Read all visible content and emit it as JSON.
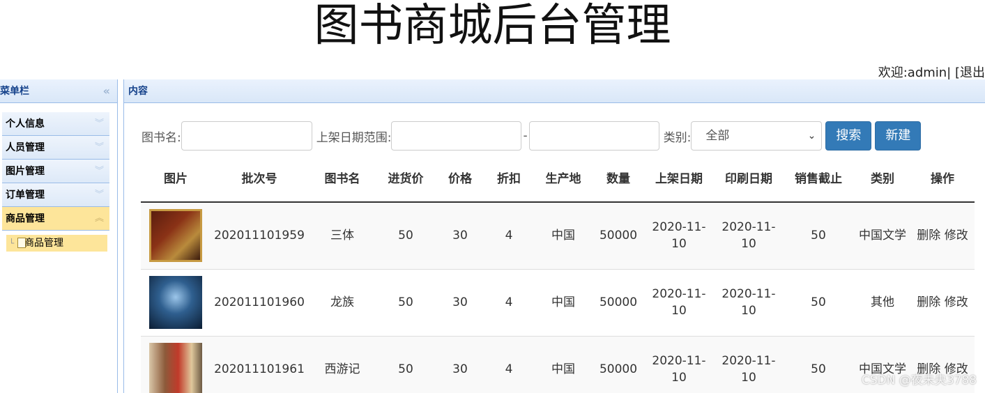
{
  "header": {
    "title": "图书商城后台管理",
    "welcome": "欢迎:admin| [退出"
  },
  "sidebar": {
    "title": "菜单栏",
    "items": [
      {
        "label": "个人信息"
      },
      {
        "label": "人员管理"
      },
      {
        "label": "图片管理"
      },
      {
        "label": "订单管理"
      },
      {
        "label": "商品管理"
      }
    ],
    "sub_item": "商品管理"
  },
  "content": {
    "title": "内容"
  },
  "search": {
    "book_name_label": "图书名:",
    "date_range_label": "上架日期范围:",
    "date_separator": "-",
    "category_label": "类别:",
    "category_selected": "全部",
    "search_button": "搜索",
    "new_button": "新建"
  },
  "table": {
    "headers": [
      "图片",
      "批次号",
      "图书名",
      "进货价",
      "价格",
      "折扣",
      "生产地",
      "数量",
      "上架日期",
      "印刷日期",
      "销售截止",
      "类别",
      "操作"
    ],
    "rows": [
      {
        "batch": "202011101959",
        "name": "三体",
        "cost": "50",
        "price": "30",
        "discount": "4",
        "origin": "中国",
        "qty": "50000",
        "shelf_date": "2020-11-10",
        "print_date": "2020-11-10",
        "sale_end": "50",
        "category": "中国文学",
        "delete": "删除",
        "edit": "修改"
      },
      {
        "batch": "202011101960",
        "name": "龙族",
        "cost": "50",
        "price": "30",
        "discount": "4",
        "origin": "中国",
        "qty": "50000",
        "shelf_date": "2020-11-10",
        "print_date": "2020-11-10",
        "sale_end": "50",
        "category": "其他",
        "delete": "删除",
        "edit": "修改"
      },
      {
        "batch": "202011101961",
        "name": "西游记",
        "cost": "50",
        "price": "30",
        "discount": "4",
        "origin": "中国",
        "qty": "50000",
        "shelf_date": "2020-11-10",
        "print_date": "2020-11-10",
        "sale_end": "50",
        "category": "中国文学",
        "delete": "删除",
        "edit": "修改"
      }
    ]
  },
  "watermark": "CSDN @夜未央3788"
}
